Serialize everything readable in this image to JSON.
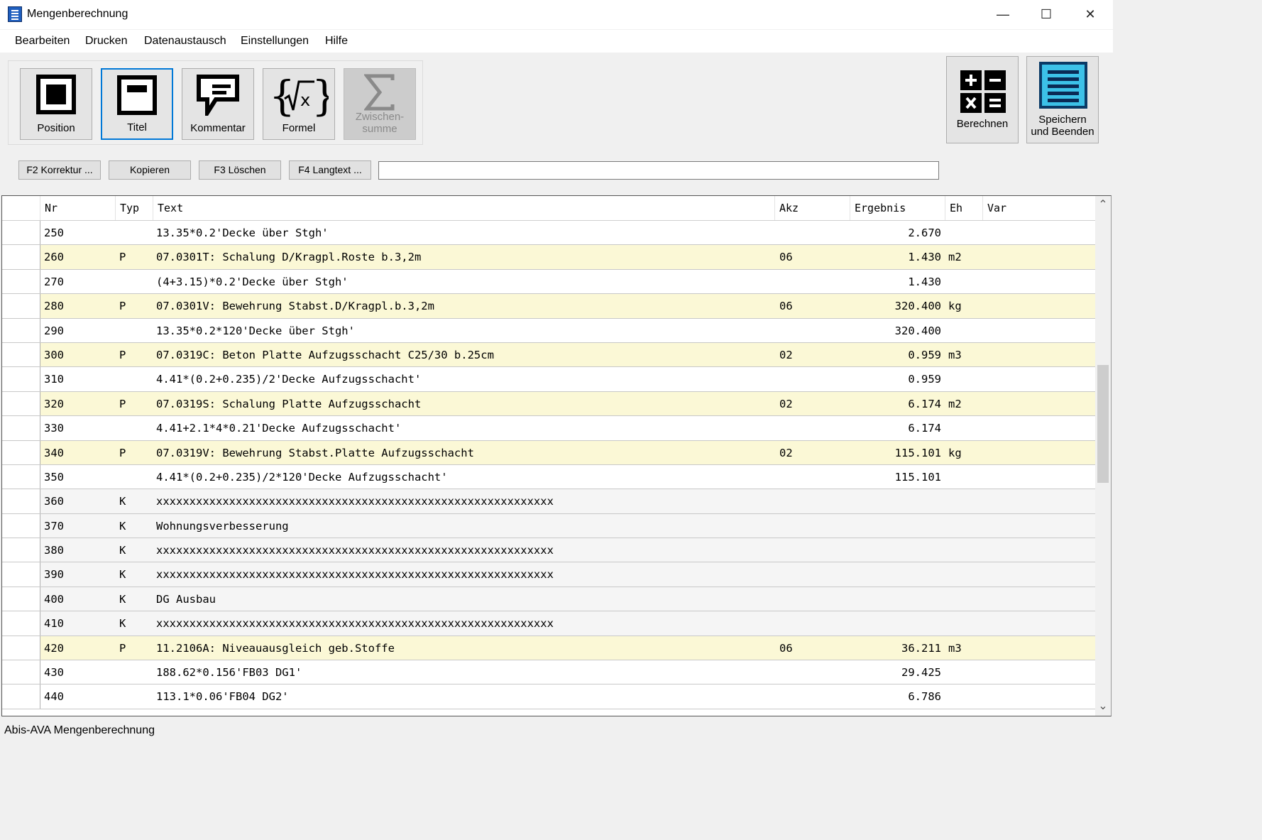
{
  "window": {
    "title": "Mengenberechnung",
    "minimize_glyph": "—",
    "maximize_glyph": "☐",
    "close_glyph": "✕"
  },
  "menu": [
    "Bearbeiten",
    "Drucken",
    "Datenaustausch",
    "Einstellungen",
    "Hilfe"
  ],
  "toolbar": {
    "position_label": "Position",
    "titel_label": "Titel",
    "kommentar_label": "Kommentar",
    "formel_label": "Formel",
    "zwischensumme_label_1": "Zwischen-",
    "zwischensumme_label_2": "summe",
    "berechnen_label": "Berechnen",
    "speichern_label_1": "Speichern",
    "speichern_label_2": "und Beenden"
  },
  "actions": {
    "korrektur": "F2 Korrektur ...",
    "kopieren": "Kopieren",
    "loeschen": "F3 Löschen",
    "langtext": "F4 Langtext ...",
    "edit_value": ""
  },
  "grid": {
    "columns": {
      "nr": "Nr",
      "typ": "Typ",
      "text": "Text",
      "akz": "Akz",
      "ergebnis": "Ergebnis",
      "eh": "Eh",
      "var": "Var"
    },
    "rows": [
      {
        "nr": "250",
        "typ": "",
        "text": "13.35*0.2'Decke über Stgh'",
        "akz": "",
        "ergebnis": "2.670",
        "eh": ""
      },
      {
        "nr": "260",
        "typ": "P",
        "text": "07.0301T: Schalung D/Kragpl.Roste b.3,2m",
        "akz": "06",
        "ergebnis": "1.430",
        "eh": "m2"
      },
      {
        "nr": "270",
        "typ": "",
        "text": "(4+3.15)*0.2'Decke über Stgh'",
        "akz": "",
        "ergebnis": "1.430",
        "eh": ""
      },
      {
        "nr": "280",
        "typ": "P",
        "text": "07.0301V: Bewehrung Stabst.D/Kragpl.b.3,2m",
        "akz": "06",
        "ergebnis": "320.400",
        "eh": "kg"
      },
      {
        "nr": "290",
        "typ": "",
        "text": "13.35*0.2*120'Decke über Stgh'",
        "akz": "",
        "ergebnis": "320.400",
        "eh": ""
      },
      {
        "nr": "300",
        "typ": "P",
        "text": "07.0319C: Beton Platte Aufzugsschacht C25/30 b.25cm",
        "akz": "02",
        "ergebnis": "0.959",
        "eh": "m3"
      },
      {
        "nr": "310",
        "typ": "",
        "text": "4.41*(0.2+0.235)/2'Decke Aufzugsschacht'",
        "akz": "",
        "ergebnis": "0.959",
        "eh": ""
      },
      {
        "nr": "320",
        "typ": "P",
        "text": "07.0319S: Schalung Platte Aufzugsschacht",
        "akz": "02",
        "ergebnis": "6.174",
        "eh": "m2"
      },
      {
        "nr": "330",
        "typ": "",
        "text": "4.41+2.1*4*0.21'Decke Aufzugsschacht'",
        "akz": "",
        "ergebnis": "6.174",
        "eh": ""
      },
      {
        "nr": "340",
        "typ": "P",
        "text": "07.0319V: Bewehrung Stabst.Platte Aufzugsschacht",
        "akz": "02",
        "ergebnis": "115.101",
        "eh": "kg"
      },
      {
        "nr": "350",
        "typ": "",
        "text": "4.41*(0.2+0.235)/2*120'Decke Aufzugsschacht'",
        "akz": "",
        "ergebnis": "115.101",
        "eh": ""
      },
      {
        "nr": "360",
        "typ": "K",
        "text": "xxxxxxxxxxxxxxxxxxxxxxxxxxxxxxxxxxxxxxxxxxxxxxxxxxxxxxxxxxxx",
        "akz": "",
        "ergebnis": "",
        "eh": ""
      },
      {
        "nr": "370",
        "typ": "K",
        "text": "Wohnungsverbesserung",
        "akz": "",
        "ergebnis": "",
        "eh": ""
      },
      {
        "nr": "380",
        "typ": "K",
        "text": "xxxxxxxxxxxxxxxxxxxxxxxxxxxxxxxxxxxxxxxxxxxxxxxxxxxxxxxxxxxx",
        "akz": "",
        "ergebnis": "",
        "eh": ""
      },
      {
        "nr": "390",
        "typ": "K",
        "text": "xxxxxxxxxxxxxxxxxxxxxxxxxxxxxxxxxxxxxxxxxxxxxxxxxxxxxxxxxxxx",
        "akz": "",
        "ergebnis": "",
        "eh": ""
      },
      {
        "nr": "400",
        "typ": "K",
        "text": "DG Ausbau",
        "akz": "",
        "ergebnis": "",
        "eh": ""
      },
      {
        "nr": "410",
        "typ": "K",
        "text": "xxxxxxxxxxxxxxxxxxxxxxxxxxxxxxxxxxxxxxxxxxxxxxxxxxxxxxxxxxxx",
        "akz": "",
        "ergebnis": "",
        "eh": ""
      },
      {
        "nr": "420",
        "typ": "P",
        "text": "11.2106A: Niveauausgleich geb.Stoffe",
        "akz": "06",
        "ergebnis": "36.211",
        "eh": "m3"
      },
      {
        "nr": "430",
        "typ": "",
        "text": "188.62*0.156'FB03 DG1'",
        "akz": "",
        "ergebnis": "29.425",
        "eh": ""
      },
      {
        "nr": "440",
        "typ": "",
        "text": "113.1*0.06'FB04 DG2'",
        "akz": "",
        "ergebnis": "6.786",
        "eh": ""
      }
    ]
  },
  "scrollbar": {
    "up_glyph": "⌃",
    "down_glyph": "⌄"
  },
  "status": {
    "text": "Abis-AVA Mengenberechnung"
  },
  "colors": {
    "position_row": "#fbf8d6",
    "comment_row": "#f5f5f5",
    "selected_border": "#0078d7",
    "icon_blue": "#1f5fbf"
  }
}
